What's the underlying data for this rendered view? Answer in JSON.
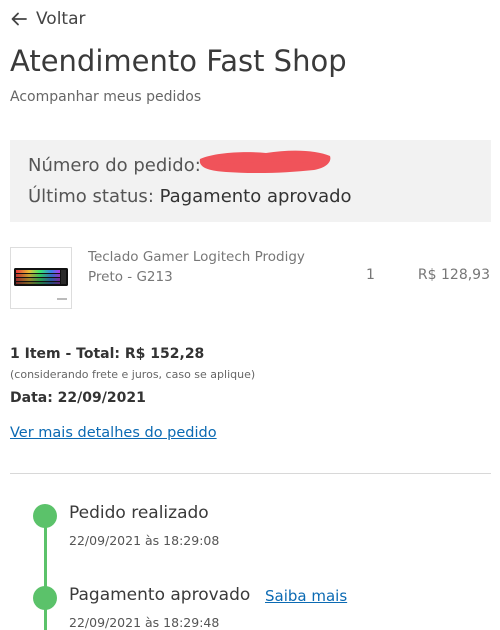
{
  "header": {
    "back_label": "Voltar",
    "back_icon": "arrow-left-icon",
    "title": "Atendimento Fast Shop",
    "subtitle": "Acompanhar meus pedidos"
  },
  "order_status": {
    "number_label": "Número do pedido:",
    "number_value_redacted": true,
    "status_label": "Último status:",
    "status_value": "Pagamento aprovado"
  },
  "product": {
    "name": "Teclado Gamer Logitech Prodigy Preto - G213",
    "quantity": "1",
    "price": "R$ 128,93"
  },
  "summary": {
    "total": "1 Item - Total: R$ 152,28",
    "note": "(considerando frete e juros, caso se aplique)",
    "date": "Data: 22/09/2021",
    "details_link": "Ver mais detalhes do pedido"
  },
  "timeline": {
    "color": "#5bc26a",
    "steps": [
      {
        "label": "Pedido realizado",
        "time": "22/09/2021 às 18:29:08"
      },
      {
        "label": "Pagamento aprovado",
        "time": "22/09/2021 às 18:29:48",
        "link": "Saiba mais"
      }
    ]
  },
  "colors": {
    "link": "#0b6ab3",
    "status_box_bg": "#f2f2f2",
    "redaction": "#f0535a"
  }
}
